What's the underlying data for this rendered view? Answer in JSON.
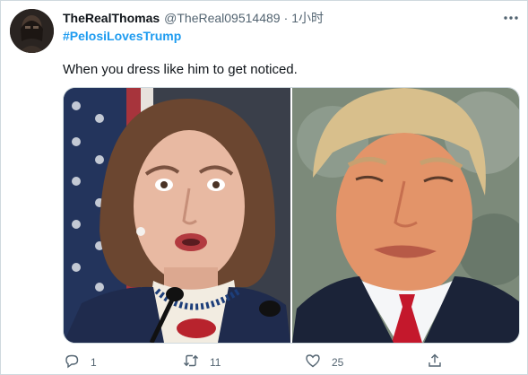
{
  "tweet": {
    "display_name": "TheRealThomas",
    "handle": "@TheReal09514489",
    "separator": "·",
    "timestamp": "1小时",
    "hashtag": "#PelosiLovesTrump",
    "text": "When you dress like him to get noticed."
  },
  "actions": {
    "reply_count": "1",
    "retweet_count": "11",
    "like_count": "25"
  },
  "icons": {
    "more": "more-horizontal-icon",
    "reply": "reply-icon",
    "retweet": "retweet-icon",
    "like": "heart-icon",
    "share": "share-icon"
  },
  "colors": {
    "name": "#0f1419",
    "secondary": "#536471",
    "link": "#1d9bf0",
    "border": "#cfd9de"
  }
}
